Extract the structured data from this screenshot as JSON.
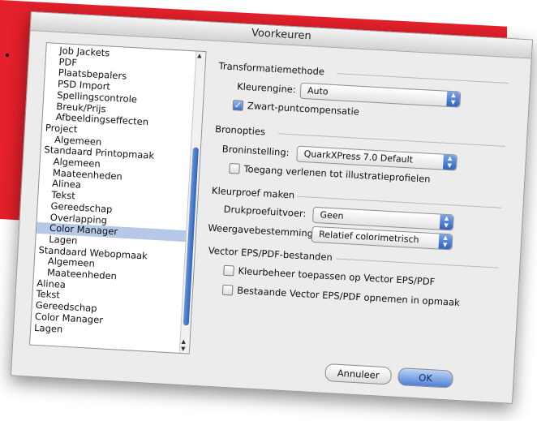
{
  "window": {
    "title": "Voorkeuren"
  },
  "sidebar": {
    "items": [
      {
        "label": "Job Jackets",
        "level": 1
      },
      {
        "label": "PDF",
        "level": 1
      },
      {
        "label": "Plaatsbepalers",
        "level": 1
      },
      {
        "label": "PSD Import",
        "level": 1
      },
      {
        "label": "Spellingscontrole",
        "level": 1
      },
      {
        "label": "Breuk/Prijs",
        "level": 1
      },
      {
        "label": "Afbeeldingseffecten",
        "level": 1
      },
      {
        "label": "Project",
        "level": 0
      },
      {
        "label": "Algemeen",
        "level": 1
      },
      {
        "label": "Standaard Printopmaak",
        "level": 0
      },
      {
        "label": "Algemeen",
        "level": 1
      },
      {
        "label": "Maateenheden",
        "level": 1
      },
      {
        "label": "Alinea",
        "level": 1
      },
      {
        "label": "Tekst",
        "level": 1
      },
      {
        "label": "Gereedschap",
        "level": 1
      },
      {
        "label": "Overlapping",
        "level": 1
      },
      {
        "label": "Color Manager",
        "level": 1,
        "selected": true
      },
      {
        "label": "Lagen",
        "level": 1
      },
      {
        "label": "Standaard Webopmaak",
        "level": 0
      },
      {
        "label": "Algemeen",
        "level": 1
      },
      {
        "label": "Maateenheden",
        "level": 1
      },
      {
        "label": "Alinea",
        "level": 0
      },
      {
        "label": "Tekst",
        "level": 0
      },
      {
        "label": "Gereedschap",
        "level": 0
      },
      {
        "label": "Color Manager",
        "level": 0
      },
      {
        "label": "Lagen",
        "level": 0
      }
    ]
  },
  "transform": {
    "title": "Transformatiemethode",
    "engine_label": "Kleurengine:",
    "engine_value": "Auto",
    "blackpoint_label": "Zwart-puntcompensatie",
    "blackpoint_checked": true
  },
  "source": {
    "title": "Bronopties",
    "setting_label": "Broninstelling:",
    "setting_value": "QuarkXPress 7.0 Default",
    "access_label": "Toegang verlenen tot illustratieprofielen",
    "access_checked": false
  },
  "proof": {
    "title": "Kleurproef maken",
    "output_label": "Drukproefuitvoer:",
    "output_value": "Geen",
    "rendering_label": "Weergavebestemming:",
    "rendering_value": "Relatief colorimetrisch"
  },
  "vector": {
    "title": "Vector EPS/PDF-bestanden",
    "apply_label": "Kleurbeheer toepassen op Vector EPS/PDF",
    "apply_checked": false,
    "include_label": "Bestaande Vector EPS/PDF opnemen in opmaak",
    "include_checked": false
  },
  "buttons": {
    "cancel": "Annuleer",
    "ok": "OK"
  },
  "colors": {
    "accent": "#3b6ac8",
    "selection": "#b5c8e8",
    "background": "#e3202b"
  },
  "icons": {
    "checkmark": "checkmark-icon",
    "popup": "up-down-arrows-icon"
  }
}
